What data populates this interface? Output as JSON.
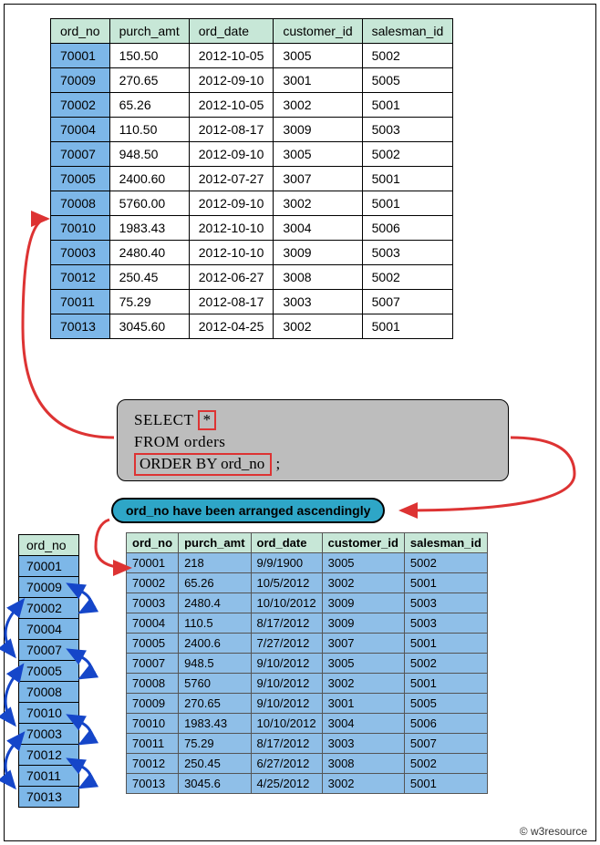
{
  "top_headers": [
    "ord_no",
    "purch_amt",
    "ord_date",
    "customer_id",
    "salesman_id"
  ],
  "top_rows": [
    [
      "70001",
      "150.50",
      "2012-10-05",
      "3005",
      "5002"
    ],
    [
      "70009",
      "270.65",
      "2012-09-10",
      "3001",
      "5005"
    ],
    [
      "70002",
      "65.26",
      "2012-10-05",
      "3002",
      "5001"
    ],
    [
      "70004",
      "110.50",
      "2012-08-17",
      "3009",
      "5003"
    ],
    [
      "70007",
      "948.50",
      "2012-09-10",
      "3005",
      "5002"
    ],
    [
      "70005",
      "2400.60",
      "2012-07-27",
      "3007",
      "5001"
    ],
    [
      "70008",
      "5760.00",
      "2012-09-10",
      "3002",
      "5001"
    ],
    [
      "70010",
      "1983.43",
      "2012-10-10",
      "3004",
      "5006"
    ],
    [
      "70003",
      "2480.40",
      "2012-10-10",
      "3009",
      "5003"
    ],
    [
      "70012",
      "250.45",
      "2012-06-27",
      "3008",
      "5002"
    ],
    [
      "70011",
      "75.29",
      "2012-08-17",
      "3003",
      "5007"
    ],
    [
      "70013",
      "3045.60",
      "2012-04-25",
      "3002",
      "5001"
    ]
  ],
  "sql": {
    "select": "SELECT",
    "star": "*",
    "from": "FROM orders",
    "orderby": "ORDER BY ord_no",
    "semi": ";"
  },
  "pill": "ord_no have been arranged ascendingly",
  "col_header": "ord_no",
  "col_values": [
    "70001",
    "70009",
    "70002",
    "70004",
    "70007",
    "70005",
    "70008",
    "70010",
    "70003",
    "70012",
    "70011",
    "70013"
  ],
  "res_headers": [
    "ord_no",
    "purch_amt",
    "ord_date",
    "customer_id",
    "salesman_id"
  ],
  "res_rows": [
    [
      "70001",
      "218",
      "9/9/1900",
      "3005",
      "5002"
    ],
    [
      "70002",
      "65.26",
      "10/5/2012",
      "3002",
      "5001"
    ],
    [
      "70003",
      "2480.4",
      "10/10/2012",
      "3009",
      "5003"
    ],
    [
      "70004",
      "110.5",
      "8/17/2012",
      "3009",
      "5003"
    ],
    [
      "70005",
      "2400.6",
      "7/27/2012",
      "3007",
      "5001"
    ],
    [
      "70007",
      "948.5",
      "9/10/2012",
      "3005",
      "5002"
    ],
    [
      "70008",
      "5760",
      "9/10/2012",
      "3002",
      "5001"
    ],
    [
      "70009",
      "270.65",
      "9/10/2012",
      "3001",
      "5005"
    ],
    [
      "70010",
      "1983.43",
      "10/10/2012",
      "3004",
      "5006"
    ],
    [
      "70011",
      "75.29",
      "8/17/2012",
      "3003",
      "5007"
    ],
    [
      "70012",
      "250.45",
      "6/27/2012",
      "3008",
      "5002"
    ],
    [
      "70013",
      "3045.6",
      "4/25/2012",
      "3002",
      "5001"
    ]
  ],
  "footer": "© w3resource"
}
